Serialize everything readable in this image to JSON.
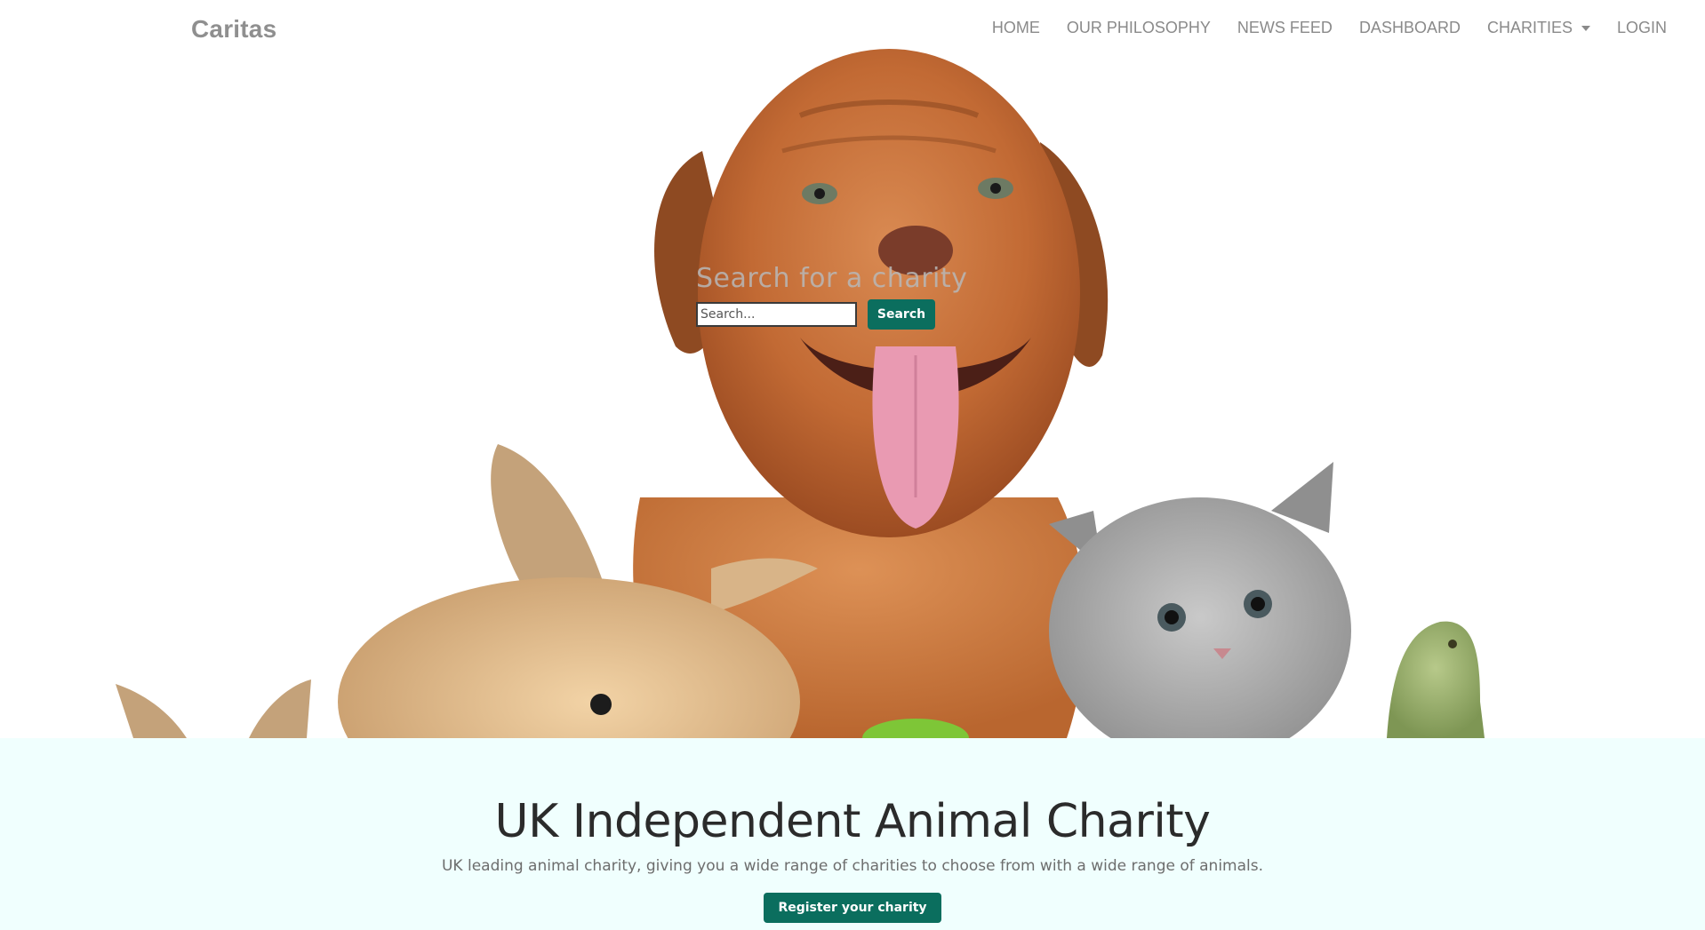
{
  "nav": {
    "brand": "Caritas",
    "links": [
      {
        "label": "HOME"
      },
      {
        "label": "OUR PHILOSOPHY"
      },
      {
        "label": "NEWS FEED"
      },
      {
        "label": "DASHBOARD"
      },
      {
        "label": "CHARITIES",
        "has_dropdown": true
      },
      {
        "label": "LOGIN"
      }
    ]
  },
  "hero": {
    "search_title": "Search for a charity",
    "search_placeholder": "Search...",
    "search_button": "Search",
    "image_subject": [
      "puppy",
      "rabbit",
      "kitten",
      "iguana",
      "green-ball"
    ]
  },
  "band": {
    "title": "UK Independent Animal Charity",
    "subtitle": "UK leading animal charity, giving you a wide range of charities to choose from with a wide range of animals.",
    "register_button": "Register your charity"
  },
  "colors": {
    "accent": "#0b6e5e",
    "band_bg": "#f0fffe",
    "nav_text": "#8a8a8a",
    "brand_text": "#8f8f8f"
  }
}
